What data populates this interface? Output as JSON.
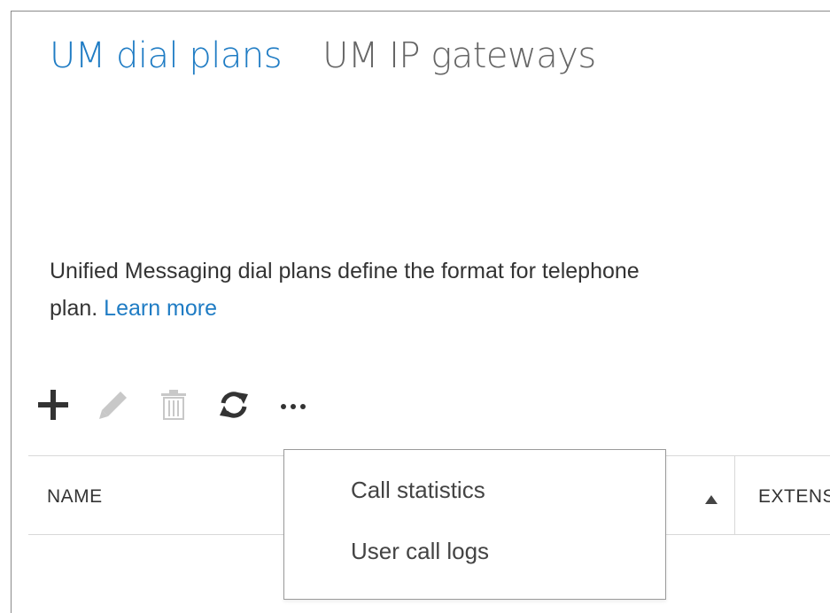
{
  "tabs": [
    {
      "label": "UM dial plans",
      "active": true
    },
    {
      "label": "UM IP gateways",
      "active": false
    }
  ],
  "description": {
    "text_line1": "Unified Messaging dial plans define the format for telephone",
    "text_line2": "plan. ",
    "link_label": "Learn more"
  },
  "toolbar": {
    "icons": [
      "plus-icon",
      "pencil-icon",
      "trash-icon",
      "refresh-icon",
      "ellipsis-icon"
    ]
  },
  "table": {
    "columns": [
      {
        "label": "NAME",
        "sort": "ascending"
      },
      {
        "label": "EXTENSIONS"
      }
    ]
  },
  "more_menu": {
    "items": [
      "Call statistics",
      "User call logs"
    ]
  },
  "colors": {
    "accent": "#1f7cc4",
    "text": "#333333",
    "disabled_icon": "#c8c8c8"
  }
}
